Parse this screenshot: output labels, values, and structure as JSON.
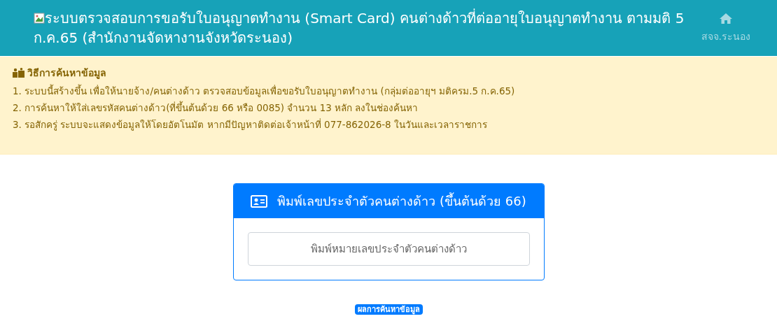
{
  "header": {
    "title": "ระบบตรวจสอบการขอรับใบอนุญาตทำงาน (Smart Card) คนต่างด้าวที่ต่ออายุใบอนุญาตทำงาน ตามมติ 5 ก.ค.65 (สำนักงานจัดหางานจังหวัดระนอง)",
    "nav_link": "สจจ.ระนอง"
  },
  "instructions": {
    "heading": "วิธีการค้นหาข้อมูล",
    "items": [
      "1. ระบบนี้สร้างขึ้น เพื่อให้นายจ้าง/คนต่างด้าว ตรวจสอบข้อมูลเพื่อขอรับใบอนุญาตทำงาน (กลุ่มต่ออายุฯ มติครม.5 ก.ค.65)",
      "2. การค้นหาให้ใส่เลขรหัสคนต่างด้าว(ที่ขึ้นต้นด้วย 66 หรือ 0085) จำนวน 13 หลัก ลงในช่องค้นหา",
      "3. รอสักครู่ ระบบจะแสดงข้อมูลให้โดยอัตโนมัต หากมีปัญหาติดต่อเจ้าหน้าที่ 077-862026-8 ในวันและเวลาราชการ"
    ]
  },
  "search_card": {
    "title": "พิมพ์เลขประจำตัวคนต่างด้าว (ขึ้นต้นด้วย 66)",
    "placeholder": "พิมพ์หมายเลขประจำตัวคนต่างด้าว"
  },
  "result_badge": "ผลการค้นหาข้อมูล"
}
